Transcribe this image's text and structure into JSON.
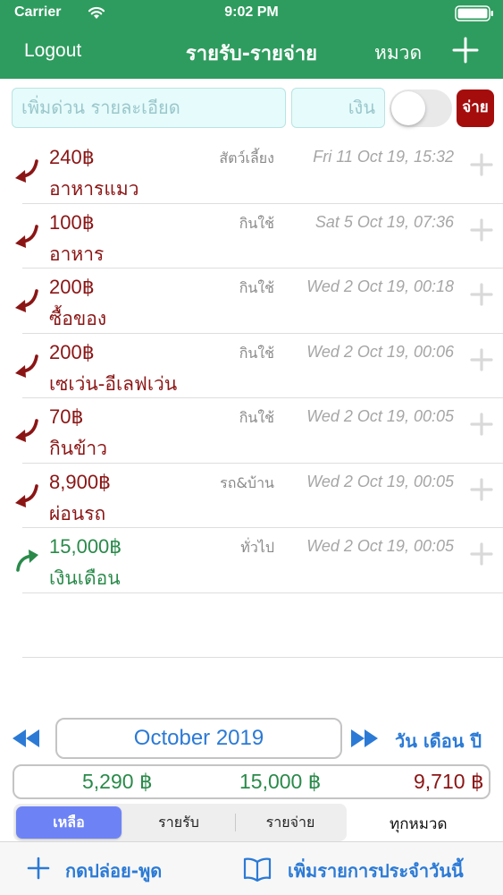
{
  "status_bar": {
    "carrier": "Carrier",
    "time": "9:02 PM"
  },
  "nav": {
    "logout": "Logout",
    "title": "รายรับ-รายจ่าย",
    "category": "หมวด"
  },
  "quick_add": {
    "detail_placeholder": "เพิ่มด่วน รายละเอียด",
    "money_placeholder": "เงิน",
    "toggle_on": false,
    "pay_label": "จ่าย"
  },
  "transactions": [
    {
      "amount": "240฿",
      "desc": "อาหารแมว",
      "category": "สัตว์เลี้ยง",
      "date": "Fri 11 Oct 19, 15:32",
      "type": "expense"
    },
    {
      "amount": "100฿",
      "desc": "อาหาร",
      "category": "กินใช้",
      "date": "Sat 5 Oct 19, 07:36",
      "type": "expense"
    },
    {
      "amount": "200฿",
      "desc": "ซื้อของ",
      "category": "กินใช้",
      "date": "Wed 2 Oct 19, 00:18",
      "type": "expense"
    },
    {
      "amount": "200฿",
      "desc": "เซเว่น-อีเลฟเว่น",
      "category": "กินใช้",
      "date": "Wed 2 Oct 19, 00:06",
      "type": "expense"
    },
    {
      "amount": "70฿",
      "desc": "กินข้าว",
      "category": "กินใช้",
      "date": "Wed 2 Oct 19, 00:05",
      "type": "expense"
    },
    {
      "amount": "8,900฿",
      "desc": "ผ่อนรถ",
      "category": "รถ&บ้าน",
      "date": "Wed 2 Oct 19, 00:05",
      "type": "expense"
    },
    {
      "amount": "15,000฿",
      "desc": "เงินเดือน",
      "category": "ทั่วไป",
      "date": "Wed 2 Oct 19, 00:05",
      "type": "income"
    }
  ],
  "month_nav": {
    "month": "October 2019",
    "day": "วัน",
    "month_label": "เดือน",
    "year": "ปี"
  },
  "totals": {
    "balance": "5,290 ฿",
    "income": "15,000 ฿",
    "expense": "9,710 ฿"
  },
  "segments": [
    "เหลือ",
    "รายรับ",
    "รายจ่าย"
  ],
  "active_segment": "เหลือ",
  "all_categories": "ทุกหมวด",
  "bottom": {
    "speak": "กดปล่อย-พูด",
    "daily": "เพิ่มรายการประจำวันนี้"
  },
  "colors": {
    "header": "#2e9c5e",
    "expense": "#8b1515",
    "income": "#2a8a4a",
    "accent": "#2b7ad6",
    "pay_button": "#a50d0d",
    "segment_active": "#6d83f5"
  },
  "icons": {
    "expense_arrow": "curved-arrow-down-left-icon",
    "income_arrow": "curved-arrow-up-right-icon",
    "add_row": "plus-icon",
    "prev": "rewind-icon",
    "next": "fast-forward-icon",
    "book": "book-icon"
  }
}
